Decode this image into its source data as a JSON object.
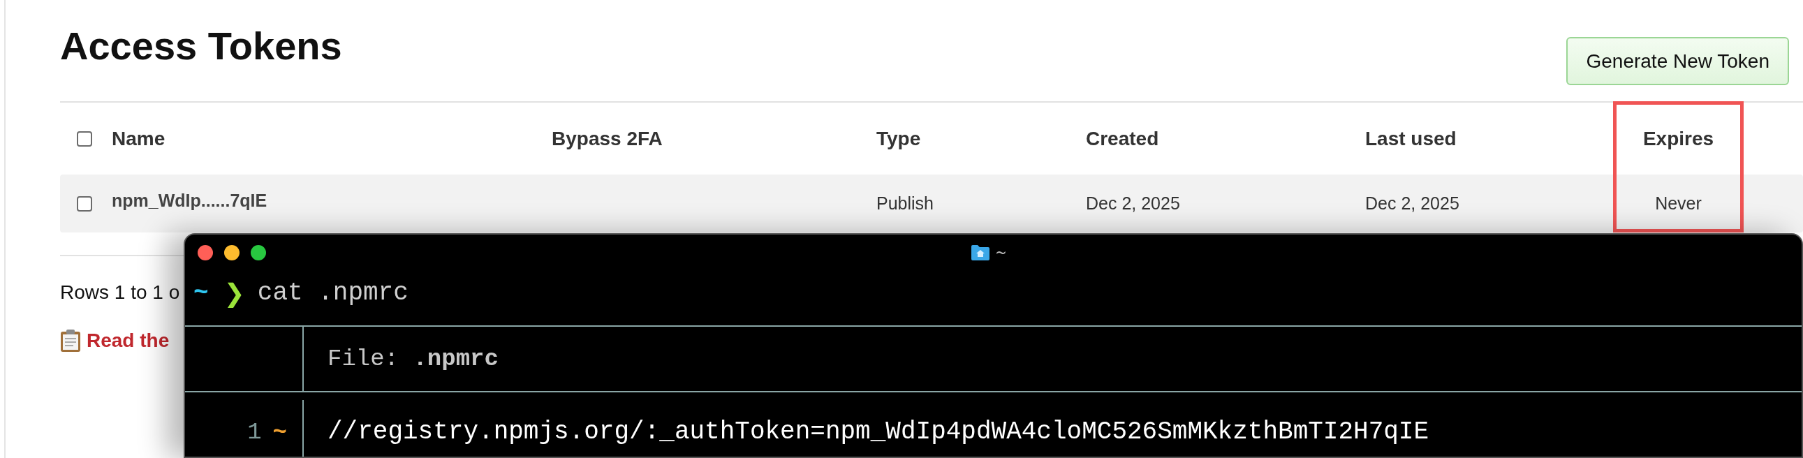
{
  "page": {
    "title": "Access Tokens",
    "generate_button": "Generate New Token"
  },
  "table": {
    "header_checkbox": {
      "checked": false
    },
    "columns": [
      {
        "label": "Name",
        "highlighted": false
      },
      {
        "label": "Bypass 2FA",
        "highlighted": false
      },
      {
        "label": "Type",
        "highlighted": false
      },
      {
        "label": "Created",
        "highlighted": false
      },
      {
        "label": "Last used",
        "highlighted": false
      },
      {
        "label": "Expires",
        "highlighted": true
      }
    ],
    "rows": [
      {
        "checked": false,
        "name": "npm_WdIp......7qIE",
        "type": "Publish",
        "created": "Dec 2, 2025",
        "last_used": "Dec 2, 2025",
        "expires": "Never"
      }
    ]
  },
  "footer": {
    "rows_text": "Rows 1 to 1 o",
    "docs_link": "Read the"
  },
  "terminal": {
    "title": "~",
    "prompt_dir": "~",
    "prompt_symbol": "❯",
    "command": "cat .npmrc",
    "file_header": "File: **.npmrc**",
    "lines": [
      {
        "number": "1",
        "marker": "~",
        "text": "//registry.npmjs.org/:_authToken=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"
      }
    ]
  }
}
